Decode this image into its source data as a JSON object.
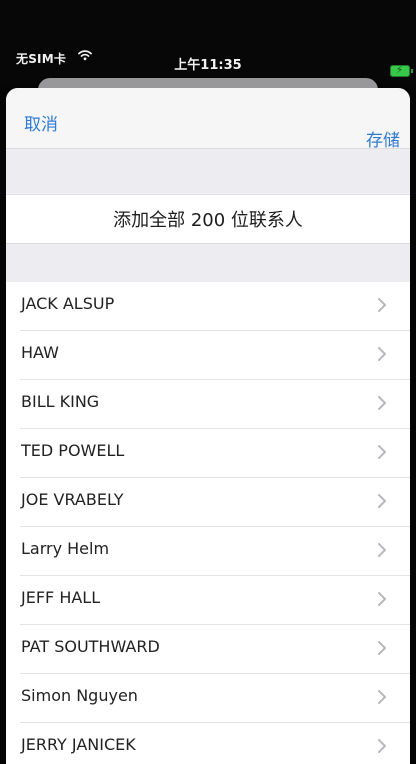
{
  "status": {
    "carrier": "无SIM卡",
    "time": "上午11:35",
    "battery_color": "#39c94a"
  },
  "nav": {
    "cancel": "取消",
    "save": "存储"
  },
  "action": {
    "add_all": "添加全部 200 位联系人"
  },
  "contacts": [
    "JACK ALSUP",
    "HAW",
    "BILL KING",
    "TED POWELL",
    "JOE VRABELY",
    "Larry Helm",
    "JEFF HALL",
    "PAT SOUTHWARD",
    "Simon Nguyen",
    "JERRY JANICEK"
  ],
  "icons": {
    "wifi": "wifi-icon",
    "battery": "battery-icon",
    "chevron": "chevron-right-icon"
  }
}
